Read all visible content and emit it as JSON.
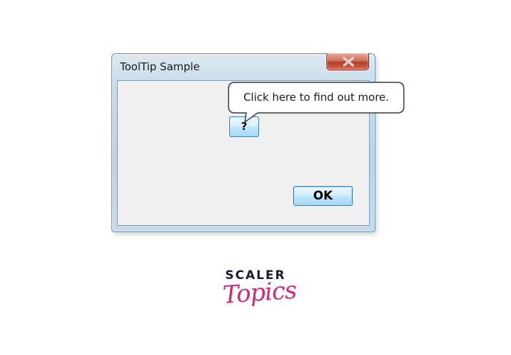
{
  "window": {
    "title": "ToolTip Sample",
    "close_icon": "close-x-icon"
  },
  "buttons": {
    "help_label": "?",
    "ok_label": "OK"
  },
  "tooltip": {
    "text": "Click here to find out more."
  },
  "logo": {
    "top_text": "SCALER",
    "bottom_text": "Topics",
    "top_color": "#1b1b2f",
    "bottom_color": "#d6267a"
  },
  "colors": {
    "window_frame": "#bdd3e3",
    "close_button": "#c8553f",
    "button_border": "#3c7fb1",
    "client_background": "#f0f0f0"
  }
}
